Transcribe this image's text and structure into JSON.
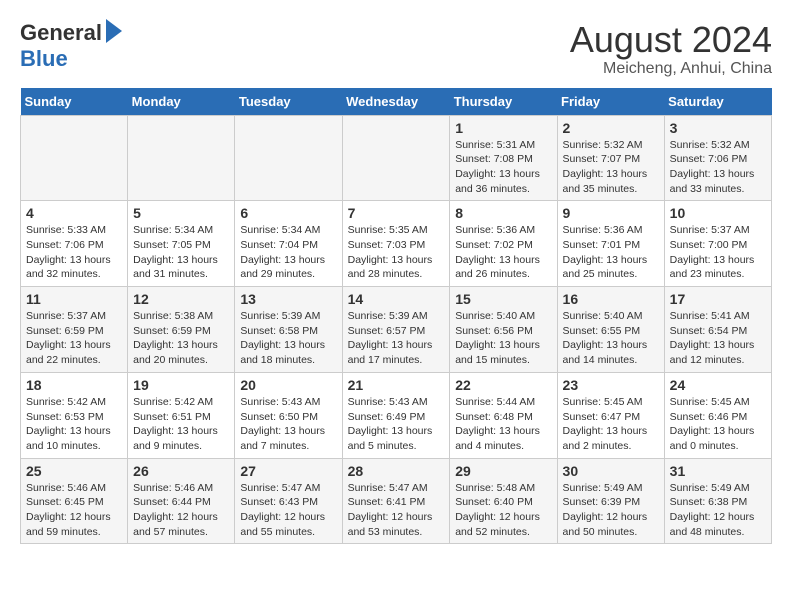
{
  "logo": {
    "general": "General",
    "blue": "Blue"
  },
  "title": "August 2024",
  "subtitle": "Meicheng, Anhui, China",
  "days_of_week": [
    "Sunday",
    "Monday",
    "Tuesday",
    "Wednesday",
    "Thursday",
    "Friday",
    "Saturday"
  ],
  "weeks": [
    [
      {
        "day": "",
        "info": ""
      },
      {
        "day": "",
        "info": ""
      },
      {
        "day": "",
        "info": ""
      },
      {
        "day": "",
        "info": ""
      },
      {
        "day": "1",
        "info": "Sunrise: 5:31 AM\nSunset: 7:08 PM\nDaylight: 13 hours and 36 minutes."
      },
      {
        "day": "2",
        "info": "Sunrise: 5:32 AM\nSunset: 7:07 PM\nDaylight: 13 hours and 35 minutes."
      },
      {
        "day": "3",
        "info": "Sunrise: 5:32 AM\nSunset: 7:06 PM\nDaylight: 13 hours and 33 minutes."
      }
    ],
    [
      {
        "day": "4",
        "info": "Sunrise: 5:33 AM\nSunset: 7:06 PM\nDaylight: 13 hours and 32 minutes."
      },
      {
        "day": "5",
        "info": "Sunrise: 5:34 AM\nSunset: 7:05 PM\nDaylight: 13 hours and 31 minutes."
      },
      {
        "day": "6",
        "info": "Sunrise: 5:34 AM\nSunset: 7:04 PM\nDaylight: 13 hours and 29 minutes."
      },
      {
        "day": "7",
        "info": "Sunrise: 5:35 AM\nSunset: 7:03 PM\nDaylight: 13 hours and 28 minutes."
      },
      {
        "day": "8",
        "info": "Sunrise: 5:36 AM\nSunset: 7:02 PM\nDaylight: 13 hours and 26 minutes."
      },
      {
        "day": "9",
        "info": "Sunrise: 5:36 AM\nSunset: 7:01 PM\nDaylight: 13 hours and 25 minutes."
      },
      {
        "day": "10",
        "info": "Sunrise: 5:37 AM\nSunset: 7:00 PM\nDaylight: 13 hours and 23 minutes."
      }
    ],
    [
      {
        "day": "11",
        "info": "Sunrise: 5:37 AM\nSunset: 6:59 PM\nDaylight: 13 hours and 22 minutes."
      },
      {
        "day": "12",
        "info": "Sunrise: 5:38 AM\nSunset: 6:59 PM\nDaylight: 13 hours and 20 minutes."
      },
      {
        "day": "13",
        "info": "Sunrise: 5:39 AM\nSunset: 6:58 PM\nDaylight: 13 hours and 18 minutes."
      },
      {
        "day": "14",
        "info": "Sunrise: 5:39 AM\nSunset: 6:57 PM\nDaylight: 13 hours and 17 minutes."
      },
      {
        "day": "15",
        "info": "Sunrise: 5:40 AM\nSunset: 6:56 PM\nDaylight: 13 hours and 15 minutes."
      },
      {
        "day": "16",
        "info": "Sunrise: 5:40 AM\nSunset: 6:55 PM\nDaylight: 13 hours and 14 minutes."
      },
      {
        "day": "17",
        "info": "Sunrise: 5:41 AM\nSunset: 6:54 PM\nDaylight: 13 hours and 12 minutes."
      }
    ],
    [
      {
        "day": "18",
        "info": "Sunrise: 5:42 AM\nSunset: 6:53 PM\nDaylight: 13 hours and 10 minutes."
      },
      {
        "day": "19",
        "info": "Sunrise: 5:42 AM\nSunset: 6:51 PM\nDaylight: 13 hours and 9 minutes."
      },
      {
        "day": "20",
        "info": "Sunrise: 5:43 AM\nSunset: 6:50 PM\nDaylight: 13 hours and 7 minutes."
      },
      {
        "day": "21",
        "info": "Sunrise: 5:43 AM\nSunset: 6:49 PM\nDaylight: 13 hours and 5 minutes."
      },
      {
        "day": "22",
        "info": "Sunrise: 5:44 AM\nSunset: 6:48 PM\nDaylight: 13 hours and 4 minutes."
      },
      {
        "day": "23",
        "info": "Sunrise: 5:45 AM\nSunset: 6:47 PM\nDaylight: 13 hours and 2 minutes."
      },
      {
        "day": "24",
        "info": "Sunrise: 5:45 AM\nSunset: 6:46 PM\nDaylight: 13 hours and 0 minutes."
      }
    ],
    [
      {
        "day": "25",
        "info": "Sunrise: 5:46 AM\nSunset: 6:45 PM\nDaylight: 12 hours and 59 minutes."
      },
      {
        "day": "26",
        "info": "Sunrise: 5:46 AM\nSunset: 6:44 PM\nDaylight: 12 hours and 57 minutes."
      },
      {
        "day": "27",
        "info": "Sunrise: 5:47 AM\nSunset: 6:43 PM\nDaylight: 12 hours and 55 minutes."
      },
      {
        "day": "28",
        "info": "Sunrise: 5:47 AM\nSunset: 6:41 PM\nDaylight: 12 hours and 53 minutes."
      },
      {
        "day": "29",
        "info": "Sunrise: 5:48 AM\nSunset: 6:40 PM\nDaylight: 12 hours and 52 minutes."
      },
      {
        "day": "30",
        "info": "Sunrise: 5:49 AM\nSunset: 6:39 PM\nDaylight: 12 hours and 50 minutes."
      },
      {
        "day": "31",
        "info": "Sunrise: 5:49 AM\nSunset: 6:38 PM\nDaylight: 12 hours and 48 minutes."
      }
    ]
  ]
}
